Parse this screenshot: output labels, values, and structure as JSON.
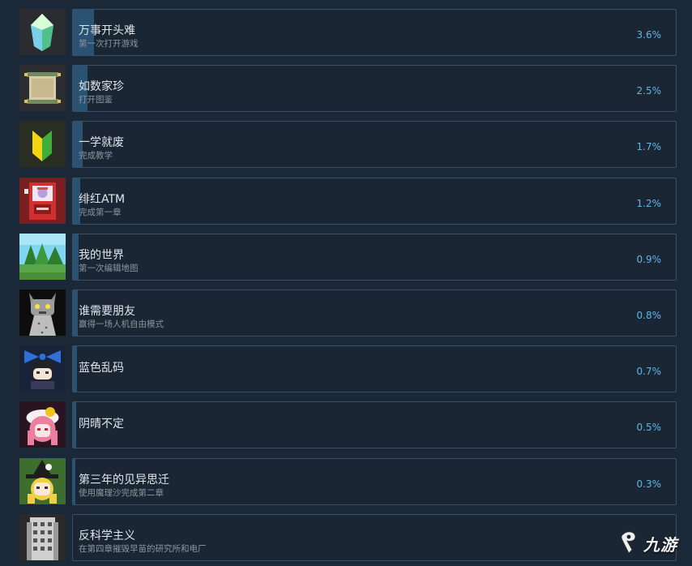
{
  "achievements": [
    {
      "title": "万事开头难",
      "desc": "第一次打开游戏",
      "percent": "3.6%",
      "percent_value": 3.6,
      "icon": "green-crystal-icon"
    },
    {
      "title": "如数家珍",
      "desc": "打开图鉴",
      "percent": "2.5%",
      "percent_value": 2.5,
      "icon": "scroll-icon"
    },
    {
      "title": "一学就废",
      "desc": "完成教学",
      "percent": "1.7%",
      "percent_value": 1.7,
      "icon": "beginner-mark-icon"
    },
    {
      "title": "绯红ATM",
      "desc": "完成第一章",
      "percent": "1.2%",
      "percent_value": 1.2,
      "icon": "red-atm-icon"
    },
    {
      "title": "我的世界",
      "desc": "第一次编辑地图",
      "percent": "0.9%",
      "percent_value": 0.9,
      "icon": "forest-landscape-icon"
    },
    {
      "title": "谁需要朋友",
      "desc": "赢得一场人机自由模式",
      "percent": "0.8%",
      "percent_value": 0.8,
      "icon": "gray-cat-robot-icon"
    },
    {
      "title": "蓝色乱码",
      "desc": "",
      "percent": "0.7%",
      "percent_value": 0.7,
      "icon": "blue-bow-girl-icon"
    },
    {
      "title": "阴晴不定",
      "desc": "",
      "percent": "0.5%",
      "percent_value": 0.5,
      "icon": "pink-hair-girl-icon"
    },
    {
      "title": "第三年的见异思迁",
      "desc": "使用魔理沙完成第二章",
      "percent": "0.3%",
      "percent_value": 0.3,
      "icon": "witch-hat-girl-icon"
    },
    {
      "title": "反科学主义",
      "desc": "在第四章摧毁早苗的研究所和电厂",
      "percent": "",
      "percent_value": null,
      "icon": "building-icon"
    }
  ],
  "watermark": {
    "text": "九游",
    "icon": "jiuyou-logo-icon"
  }
}
